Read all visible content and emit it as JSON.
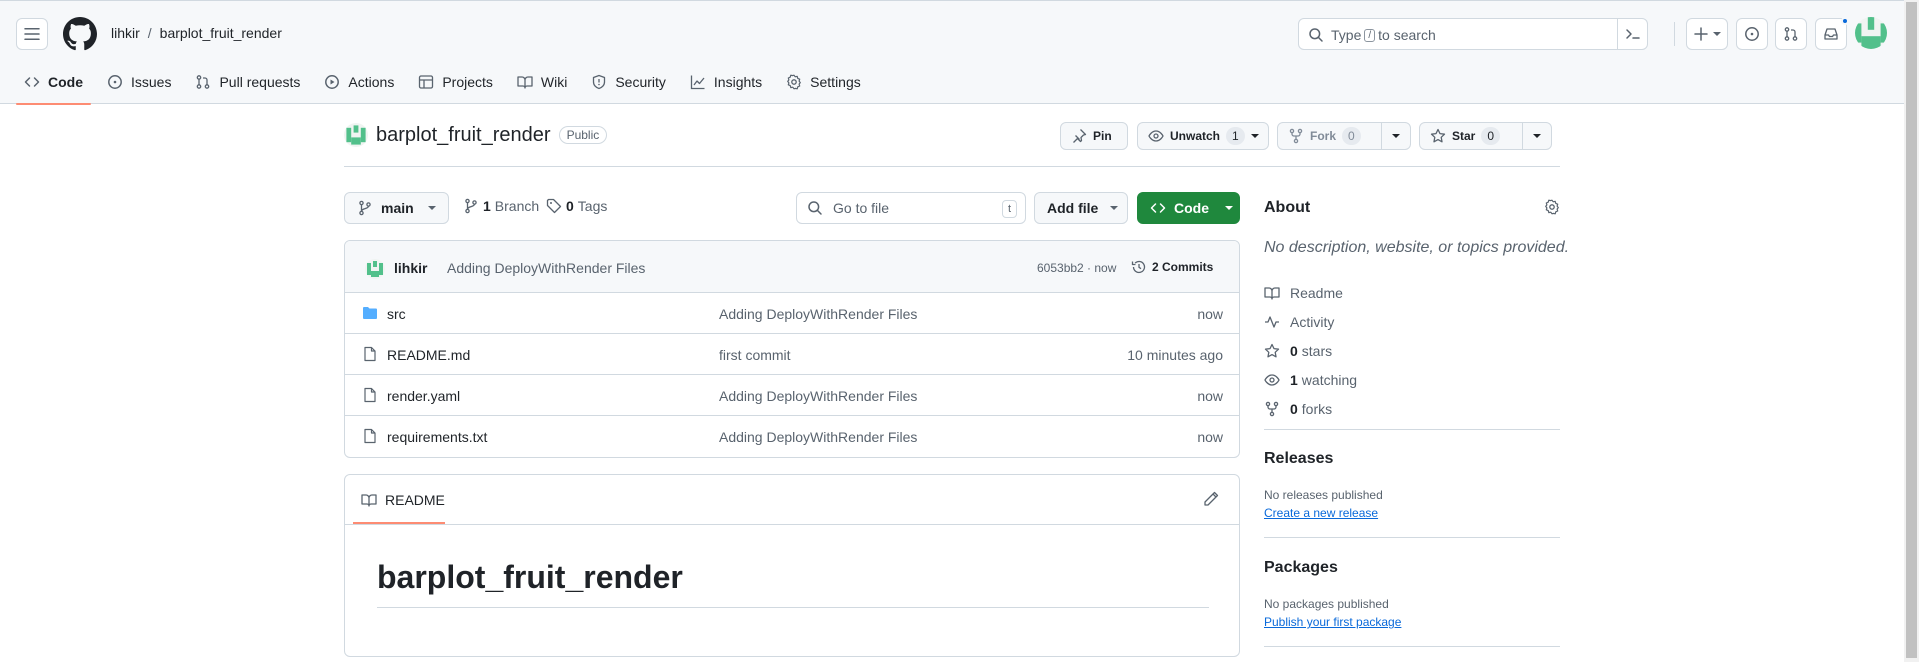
{
  "header": {
    "owner": "lihkir",
    "separator": "/",
    "repo": "barplot_fruit_render",
    "search_prefix": "Type",
    "search_key": "/",
    "search_suffix": "to search"
  },
  "nav": {
    "tabs": [
      {
        "label": "Code",
        "icon": "code-icon"
      },
      {
        "label": "Issues",
        "icon": "issue-icon"
      },
      {
        "label": "Pull requests",
        "icon": "pull-request-icon"
      },
      {
        "label": "Actions",
        "icon": "play-icon"
      },
      {
        "label": "Projects",
        "icon": "table-icon"
      },
      {
        "label": "Wiki",
        "icon": "book-icon"
      },
      {
        "label": "Security",
        "icon": "shield-icon"
      },
      {
        "label": "Insights",
        "icon": "graph-icon"
      },
      {
        "label": "Settings",
        "icon": "gear-icon"
      }
    ]
  },
  "repo": {
    "name": "barplot_fruit_render",
    "visibility": "Public",
    "pin_label": "Pin",
    "unwatch_label": "Unwatch",
    "watch_count": "1",
    "fork_label": "Fork",
    "fork_count": "0",
    "star_label": "Star",
    "star_count": "0"
  },
  "toolbar": {
    "branch": "main",
    "branch_count": "1",
    "branch_label": "Branch",
    "tag_count": "0",
    "tag_label": "Tags",
    "goto_placeholder": "Go to file",
    "goto_key": "t",
    "add_file": "Add file",
    "code": "Code"
  },
  "commit": {
    "author": "lihkir",
    "message": "Adding DeployWithRender Files",
    "sha_time": "6053bb2 · now",
    "commits": "2 Commits"
  },
  "files": [
    {
      "name": "src",
      "type": "folder",
      "message": "Adding DeployWithRender Files",
      "time": "now"
    },
    {
      "name": "README.md",
      "type": "file",
      "message": "first commit",
      "time": "10 minutes ago"
    },
    {
      "name": "render.yaml",
      "type": "file",
      "message": "Adding DeployWithRender Files",
      "time": "now"
    },
    {
      "name": "requirements.txt",
      "type": "file",
      "message": "Adding DeployWithRender Files",
      "time": "now"
    }
  ],
  "readme": {
    "tab_label": "README",
    "heading": "barplot_fruit_render"
  },
  "about": {
    "title": "About",
    "description": "No description, website, or topics provided.",
    "readme_label": "Readme",
    "activity_label": "Activity",
    "stars_count": "0",
    "stars_label": "stars",
    "watching_count": "1",
    "watching_label": "watching",
    "forks_count": "0",
    "forks_label": "forks"
  },
  "releases": {
    "title": "Releases",
    "note": "No releases published",
    "link": "Create a new release"
  },
  "packages": {
    "title": "Packages",
    "note": "No packages published",
    "link": "Publish your first package"
  },
  "colors": {
    "accent": "#0969da",
    "primary_button": "#1f883d",
    "tab_underline": "#fd8c73",
    "folder": "#54aeff"
  }
}
